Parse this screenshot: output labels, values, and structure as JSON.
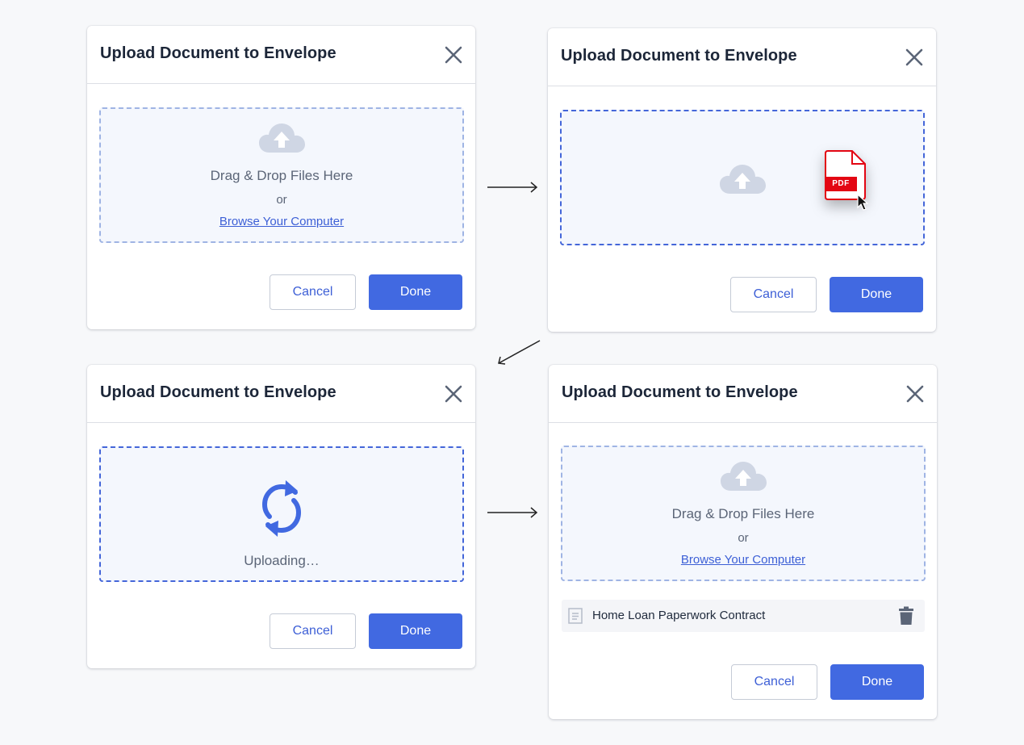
{
  "dialog": {
    "title": "Upload Document to Envelope",
    "cancel_label": "Cancel",
    "done_label": "Done"
  },
  "dropzone": {
    "primary_text": "Drag & Drop Files Here",
    "or_text": "or",
    "browse_link": "Browse Your Computer",
    "uploading_text": "Uploading…"
  },
  "drag_file": {
    "badge": "PDF"
  },
  "uploaded_file": {
    "name": "Home Loan Paperwork Contract"
  },
  "colors": {
    "primary": "#4169e1",
    "pdf_red": "#e30613",
    "cloud": "#cfd6e4"
  },
  "icons": {
    "close": "close-icon",
    "cloud": "cloud-upload-icon",
    "spinner": "sync-icon",
    "document": "document-icon",
    "delete": "trash-icon",
    "cursor": "mouse-pointer-icon"
  }
}
